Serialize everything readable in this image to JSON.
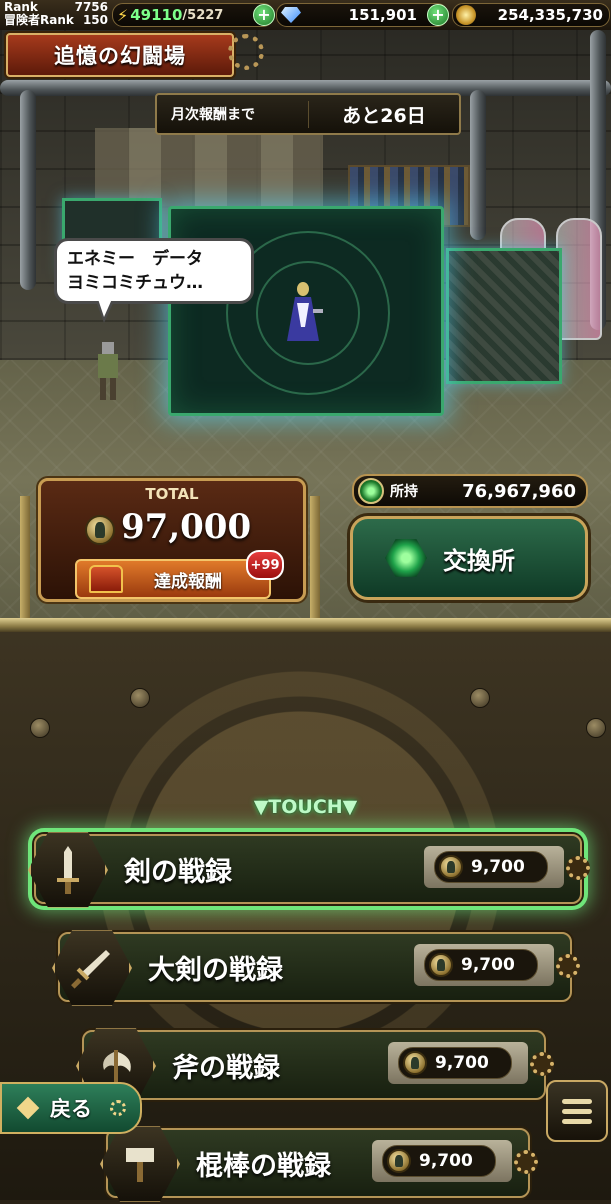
{
  "status_bar": {
    "rank_label": "Rank",
    "rank_value": "7756",
    "adventurer_rank_label": "冒険者Rank",
    "adventurer_rank_value": "150",
    "stamina": "49110",
    "stamina_max": "/5227",
    "gems": "151,901",
    "gold": "254,335,730",
    "plus_symbol": "+"
  },
  "header": {
    "title": "追憶の幻闘場",
    "monthly_label": "月次報酬まで",
    "monthly_value": "あと26日"
  },
  "scene": {
    "speech_line1": "エネミー　データ",
    "speech_line2": "ヨミコミチュウ…"
  },
  "total": {
    "label": "TOTAL",
    "value": "97,000",
    "reward_button": "達成報酬",
    "reward_badge": "+99"
  },
  "shop": {
    "owned_label": "所持",
    "owned_value": "76,967,960",
    "exchange_label": "交換所"
  },
  "records": {
    "touch_hint": "▼TOUCH▼",
    "items": [
      {
        "name": "剣の戦録",
        "cost": "9,700",
        "icon": "sword-icon",
        "selected": true
      },
      {
        "name": "大剣の戦録",
        "cost": "9,700",
        "icon": "greatsword-icon",
        "selected": false
      },
      {
        "name": "斧の戦録",
        "cost": "9,700",
        "icon": "axe-icon",
        "selected": false
      },
      {
        "name": "棍棒の戦録",
        "cost": "9,700",
        "icon": "club-icon",
        "selected": false
      }
    ]
  },
  "nav": {
    "back_label": "戻る",
    "menu_icon": "hamburger-menu-icon"
  },
  "colors": {
    "accent_gold": "#c9a964",
    "selection_glow": "#6fe57a",
    "title_red": "#a63a1c"
  }
}
